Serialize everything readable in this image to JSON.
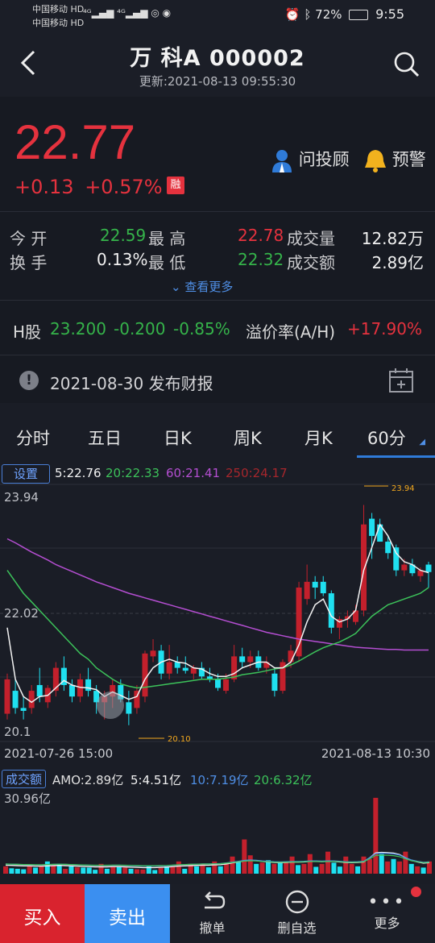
{
  "status_bar": {
    "carrier1": "中国移动 HD",
    "carrier2": "中国移动 HD",
    "battery": "72%",
    "time": "9:55"
  },
  "header": {
    "title": "万 科A 000002",
    "updated": "更新:2021-08-13 09:55:30"
  },
  "quote": {
    "price": "22.77",
    "change": "+0.13",
    "change_pct": "+0.57%",
    "badge": "融",
    "advisor_label": "问投顾",
    "alert_label": "预警",
    "open_label": "今 开",
    "open_value": "22.59",
    "high_label": "最 高",
    "high_value": "22.78",
    "volume_label": "成交量",
    "volume_value": "12.82万",
    "turnover_label": "换 手",
    "turnover_value": "0.13%",
    "low_label": "最 低",
    "low_value": "22.32",
    "amount_label": "成交额",
    "amount_value": "2.89亿",
    "more_label": "查看更多",
    "h_label": "H股",
    "h_price": "23.200",
    "h_change": "-0.200",
    "h_pct": "-0.85%",
    "premium_label": "溢价率(A/H)",
    "premium_value": "+17.90%",
    "report": "2021-08-30 发布财报"
  },
  "tabs": [
    "分时",
    "五日",
    "日K",
    "周K",
    "月K",
    "60分"
  ],
  "chart_bar": {
    "settings": "设置",
    "ma5": "5:22.76",
    "ma20": "20:22.33",
    "ma60": "60:21.41",
    "ma250": "250:24.17"
  },
  "chart_data": [
    {
      "type": "candlestick",
      "ylim": [
        19.9,
        24.2
      ],
      "y_ticks": [
        "23.94",
        "22.02",
        "20.1"
      ],
      "x_labels": [
        "2021-07-26 15:00",
        "2021-08-13 10:30"
      ],
      "max_label": "23.94",
      "min_label": "20.10",
      "candles": [
        {
          "o": 20.3,
          "h": 21.0,
          "l": 20.2,
          "c": 20.9
        },
        {
          "o": 20.7,
          "h": 20.9,
          "l": 20.3,
          "c": 20.4
        },
        {
          "o": 20.4,
          "h": 20.6,
          "l": 20.2,
          "c": 20.35
        },
        {
          "o": 20.4,
          "h": 20.8,
          "l": 20.3,
          "c": 20.7
        },
        {
          "o": 20.8,
          "h": 21.1,
          "l": 20.5,
          "c": 20.6
        },
        {
          "o": 20.5,
          "h": 20.8,
          "l": 20.4,
          "c": 20.75
        },
        {
          "o": 20.7,
          "h": 21.2,
          "l": 20.6,
          "c": 21.1
        },
        {
          "o": 21.1,
          "h": 21.3,
          "l": 20.7,
          "c": 20.8
        },
        {
          "o": 20.8,
          "h": 20.9,
          "l": 20.5,
          "c": 20.6
        },
        {
          "o": 20.6,
          "h": 21.0,
          "l": 20.5,
          "c": 20.9
        },
        {
          "o": 20.9,
          "h": 21.1,
          "l": 20.6,
          "c": 20.7
        },
        {
          "o": 20.7,
          "h": 20.8,
          "l": 20.3,
          "c": 20.5
        },
        {
          "o": 20.5,
          "h": 20.7,
          "l": 20.2,
          "c": 20.6
        },
        {
          "o": 20.6,
          "h": 20.9,
          "l": 20.4,
          "c": 20.8
        },
        {
          "o": 20.8,
          "h": 20.9,
          "l": 20.5,
          "c": 20.55
        },
        {
          "o": 20.5,
          "h": 20.7,
          "l": 20.1,
          "c": 20.3
        },
        {
          "o": 20.4,
          "h": 20.8,
          "l": 20.3,
          "c": 20.7
        },
        {
          "o": 20.6,
          "h": 21.4,
          "l": 20.5,
          "c": 21.35
        },
        {
          "o": 21.3,
          "h": 21.6,
          "l": 21.2,
          "c": 21.4
        },
        {
          "o": 21.4,
          "h": 21.5,
          "l": 20.9,
          "c": 21.0
        },
        {
          "o": 21.0,
          "h": 21.5,
          "l": 20.9,
          "c": 21.2
        },
        {
          "o": 21.2,
          "h": 21.3,
          "l": 21.0,
          "c": 21.1
        },
        {
          "o": 21.1,
          "h": 21.3,
          "l": 21.0,
          "c": 21.05
        },
        {
          "o": 21.0,
          "h": 21.15,
          "l": 20.9,
          "c": 21.1
        },
        {
          "o": 21.1,
          "h": 21.2,
          "l": 20.9,
          "c": 20.95
        },
        {
          "o": 20.95,
          "h": 21.1,
          "l": 20.85,
          "c": 20.9
        },
        {
          "o": 20.9,
          "h": 21.0,
          "l": 20.7,
          "c": 20.75
        },
        {
          "o": 20.7,
          "h": 21.0,
          "l": 20.65,
          "c": 20.9
        },
        {
          "o": 20.9,
          "h": 21.5,
          "l": 20.85,
          "c": 21.3
        },
        {
          "o": 21.3,
          "h": 21.45,
          "l": 21.1,
          "c": 21.2
        },
        {
          "o": 21.2,
          "h": 21.4,
          "l": 21.1,
          "c": 21.3
        },
        {
          "o": 21.3,
          "h": 21.4,
          "l": 21.05,
          "c": 21.1
        },
        {
          "o": 21.1,
          "h": 21.3,
          "l": 21.0,
          "c": 21.2
        },
        {
          "o": 21.0,
          "h": 21.1,
          "l": 20.6,
          "c": 20.7
        },
        {
          "o": 20.7,
          "h": 21.25,
          "l": 20.65,
          "c": 21.2
        },
        {
          "o": 21.2,
          "h": 21.5,
          "l": 21.1,
          "c": 21.4
        },
        {
          "o": 21.3,
          "h": 22.6,
          "l": 21.2,
          "c": 22.5
        },
        {
          "o": 22.3,
          "h": 22.9,
          "l": 22.2,
          "c": 22.6
        },
        {
          "o": 22.6,
          "h": 22.7,
          "l": 22.3,
          "c": 22.5
        },
        {
          "o": 22.6,
          "h": 22.7,
          "l": 22.35,
          "c": 22.4
        },
        {
          "o": 22.4,
          "h": 22.45,
          "l": 21.7,
          "c": 21.8
        },
        {
          "o": 21.8,
          "h": 22.0,
          "l": 21.6,
          "c": 21.95
        },
        {
          "o": 21.95,
          "h": 22.1,
          "l": 21.8,
          "c": 22.0
        },
        {
          "o": 21.9,
          "h": 22.2,
          "l": 21.85,
          "c": 22.1
        },
        {
          "o": 22.1,
          "h": 23.94,
          "l": 22.0,
          "c": 23.6
        },
        {
          "o": 23.7,
          "h": 23.8,
          "l": 23.0,
          "c": 23.4
        },
        {
          "o": 23.6,
          "h": 23.7,
          "l": 23.3,
          "c": 23.3
        },
        {
          "o": 23.3,
          "h": 23.4,
          "l": 23.0,
          "c": 23.1
        },
        {
          "o": 23.2,
          "h": 23.25,
          "l": 22.7,
          "c": 22.8
        },
        {
          "o": 22.8,
          "h": 23.0,
          "l": 22.7,
          "c": 22.9
        },
        {
          "o": 22.9,
          "h": 23.0,
          "l": 22.7,
          "c": 22.75
        },
        {
          "o": 22.7,
          "h": 22.85,
          "l": 22.6,
          "c": 22.8
        },
        {
          "o": 22.9,
          "h": 22.95,
          "l": 22.5,
          "c": 22.77
        }
      ],
      "ma5": [
        21.8,
        20.9,
        20.6,
        20.5,
        20.6,
        20.62,
        20.75,
        20.88,
        20.8,
        20.76,
        20.75,
        20.72,
        20.6,
        20.68,
        20.62,
        20.55,
        20.6,
        20.9,
        21.1,
        21.2,
        21.25,
        21.2,
        21.18,
        21.1,
        21.08,
        21.0,
        20.95,
        20.95,
        21.0,
        21.1,
        21.15,
        21.2,
        21.2,
        21.1,
        21.1,
        21.2,
        21.5,
        21.9,
        22.2,
        22.3,
        22.0,
        21.9,
        21.95,
        22.1,
        22.8,
        23.2,
        23.6,
        23.4,
        23.1,
        22.95,
        22.9,
        22.8,
        22.76
      ],
      "ma20": [
        22.8,
        22.6,
        22.4,
        22.25,
        22.1,
        21.95,
        21.8,
        21.65,
        21.5,
        21.35,
        21.25,
        21.1,
        21.0,
        20.9,
        20.82,
        20.78,
        20.75,
        20.76,
        20.78,
        20.8,
        20.82,
        20.84,
        20.86,
        20.88,
        20.9,
        20.9,
        20.9,
        20.92,
        20.94,
        20.98,
        21.0,
        21.02,
        21.05,
        21.08,
        21.1,
        21.15,
        21.22,
        21.3,
        21.38,
        21.45,
        21.5,
        21.55,
        21.62,
        21.7,
        21.85,
        22.0,
        22.1,
        22.2,
        22.25,
        22.3,
        22.35,
        22.4,
        22.5
      ],
      "ma60": [
        23.35,
        23.28,
        23.2,
        23.12,
        23.05,
        22.98,
        22.9,
        22.84,
        22.78,
        22.72,
        22.66,
        22.6,
        22.55,
        22.5,
        22.45,
        22.4,
        22.36,
        22.32,
        22.28,
        22.24,
        22.2,
        22.16,
        22.12,
        22.08,
        22.04,
        22.0,
        21.96,
        21.92,
        21.88,
        21.84,
        21.8,
        21.76,
        21.72,
        21.69,
        21.66,
        21.63,
        21.6,
        21.58,
        21.56,
        21.54,
        21.52,
        21.5,
        21.48,
        21.46,
        21.45,
        21.44,
        21.43,
        21.42,
        21.42,
        21.41,
        21.41,
        21.41,
        21.41
      ]
    },
    {
      "type": "bar",
      "title": "成交额",
      "amo": "AMO:2.89亿",
      "ma5": "5:4.51亿",
      "ma10": "10:7.19亿",
      "ma20": "20:6.32亿",
      "y_max_label": "30.96亿",
      "ylim": [
        0,
        30.96
      ],
      "values": [
        3,
        2.2,
        2,
        1.8,
        3.2,
        2.5,
        3,
        5,
        3.5,
        4,
        2,
        3,
        2.6,
        2.5,
        2.5,
        1.6,
        4,
        2,
        3,
        3,
        2.5,
        2,
        1.8,
        1.7,
        3,
        1.5,
        2.4,
        3,
        2.8,
        5,
        2,
        4,
        3,
        4,
        2.6,
        5,
        3,
        4,
        7,
        5,
        14,
        7.5,
        4,
        4.5,
        5.5,
        4,
        4.5,
        5,
        7,
        3.5,
        4,
        8,
        2.8,
        4,
        9,
        4.5,
        2.9,
        7,
        4,
        3,
        7,
        6,
        31,
        8,
        5,
        6,
        5,
        9,
        4,
        3,
        2.5,
        5
      ],
      "up": [
        1,
        0,
        0,
        0,
        1,
        0,
        1,
        0,
        1,
        0,
        1,
        0,
        1,
        0,
        0,
        0,
        1,
        0,
        1,
        0,
        1,
        0,
        1,
        1,
        0,
        0,
        1,
        0,
        1,
        1,
        0,
        1,
        0,
        1,
        0,
        1,
        0,
        1,
        1,
        0,
        1,
        1,
        0,
        1,
        0,
        1,
        0,
        1,
        1,
        0,
        1,
        1,
        0,
        1,
        1,
        0,
        0,
        1,
        1,
        0,
        1,
        1,
        1,
        0,
        1,
        0,
        1,
        1,
        0,
        1,
        0,
        1
      ],
      "ma": [
        3.5,
        3.4,
        3.3,
        3.2,
        3.2,
        3.1,
        3.1,
        3.2,
        3.3,
        3.4,
        3.3,
        3.2,
        3.1,
        3.0,
        2.9,
        2.8,
        2.8,
        2.8,
        2.9,
        2.9,
        2.8,
        2.7,
        2.6,
        2.5,
        2.5,
        2.5,
        2.6,
        2.7,
        2.9,
        3.1,
        3.2,
        3.3,
        3.4,
        3.5,
        3.5,
        3.6,
        3.7,
        4.0,
        4.4,
        4.8,
        5.2,
        5.4,
        5.3,
        5.0,
        4.8,
        4.6,
        4.5,
        4.6,
        4.7,
        4.7,
        4.8,
        5.0,
        5.0,
        4.9,
        5.0,
        5.0,
        4.8,
        4.6,
        4.5,
        4.6,
        4.8,
        6.5,
        8.5,
        8.7,
        8.6,
        8.4,
        7.8,
        6.5,
        5.4,
        4.8,
        4.3,
        4.51
      ]
    }
  ],
  "bottom_bar": {
    "buy": "买入",
    "sell": "卖出",
    "cancel": "撤单",
    "remove": "删自选",
    "more": "更多"
  }
}
